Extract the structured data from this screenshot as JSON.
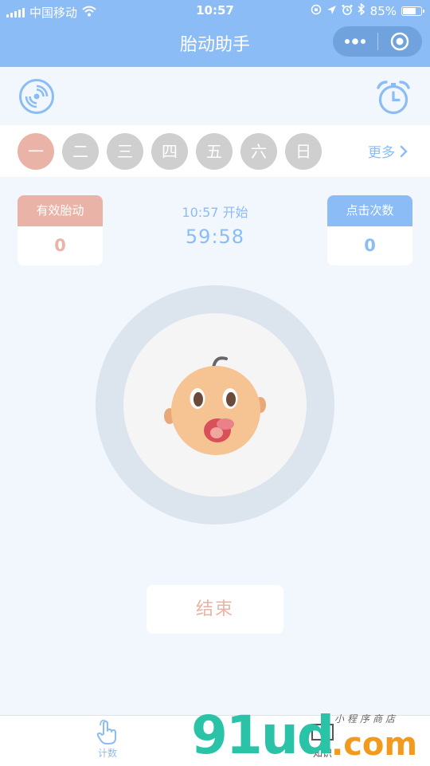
{
  "status_bar": {
    "carrier": "中国移动",
    "time": "10:57",
    "battery": "85%",
    "battery_level": 0.85
  },
  "nav": {
    "title": "胎动助手"
  },
  "days": [
    "一",
    "二",
    "三",
    "四",
    "五",
    "六",
    "日"
  ],
  "active_day_index": 0,
  "more_label": "更多",
  "cards": {
    "effective_label": "有效胎动",
    "effective_value": "0",
    "clicks_label": "点击次数",
    "clicks_value": "0"
  },
  "timer": {
    "start_text": "10:57 开始",
    "countdown": "59:58"
  },
  "end_button": "结束",
  "tabs": {
    "count": "计数",
    "knowledge": "知识"
  },
  "watermark": {
    "logo": "91ud",
    "suffix": ".com",
    "sub": "小程序商店"
  },
  "colors": {
    "primary_blue": "#8cbcf5",
    "accent_pink": "#e9b3a7",
    "background": "#f2f7fd",
    "inactive_day": "#cfcfcf"
  }
}
